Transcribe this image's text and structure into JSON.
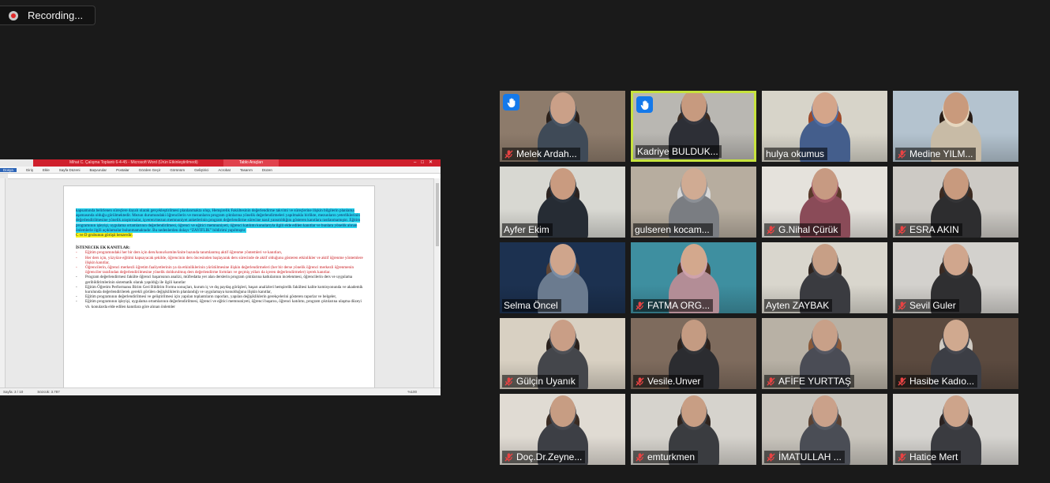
{
  "recording": {
    "label": "Recording..."
  },
  "word": {
    "title_doc": "Mihat C. Çalışma Toplantı 6-4-45 - Microsoft Word (Ürün Etkinleştirilmedi)",
    "table_tools": "Tablo Araçları",
    "tabs": [
      "Dosya",
      "Giriş",
      "Ekle",
      "Sayfa Düzeni",
      "Başvurular",
      "Postalar",
      "Gözden Geçir",
      "Görünüm",
      "Geliştirici",
      "Acrobat",
      "Tasarım",
      "Düzen"
    ],
    "status_page": "Sayfa: 3 / 10",
    "status_words": "Sözcük: 3.787",
    "status_zoom": "%100",
    "highlight_para": "kapsamında belirlenen süreçlere dayalı olarak gerçekleştirilmesi planlanmakta olup, Hemşirelik Fakültesinin değerlendirme takvimi ve süreçlerine ilişkin bilgilerin planlama aşamasında olduğu görülmektedir. Mezun durumundaki öğrencilerin ve mezunların program çıktılarına yönelik değerlendirmeleri yapılmakla birlikte, mezunların yeterliklerinin değerlendirilmesine yönelik araştırmalar, işveren/mezun memnuniyet anketlerinin program değerlendirme sürecine nasıl yansıtıldığını gösteren kanıtlara rastlanmamıştır. Eğitim programının işleyişi, uygulama ortamlarının değerlendirilmesi, öğrenci ve eğitici memnuniyeti, öğrenci katılımı konularıyla ilgili elde edilen kanıtlar ve bunlara yönelik alınan önlemlerle ilgili açıklamalar bulunmamaktadır. Bu nedenlerden dolayı “ZAYIFLIK” bildirimi yapılmıştır.",
    "yellow_line": "C ve D grubunun görüşü benzerdir.",
    "heading": "İSTENECEK EK KANITLAR:",
    "bullets": [
      {
        "text": "Eğitim programındaki her bir ders için ders/konu/komite/ünite bazında tanımlanmış aktif öğrenme yöntemleri ve kanıtları,",
        "color": "red"
      },
      {
        "text": "Her ders için, yüzyüze eğitimi kapsayacak şekilde, öğrencinin ders öncesinden başlayarak ders sürecinde de aktif olduğunu gösteren etkinlikler ve aktif öğrenme yöntemlere ilişkin kanıtlar,",
        "color": "red"
      },
      {
        "text": "Öğrencilerin, öğrenci merkezli öğretim faaliyetlerinin ya da etkinliklerinin yürütülmesine ilişkin değerlendirmeleri (her bir derse yönelik öğrenci merkezli öğrenmenin öğrenciler tarafından değerlendirilmesine yönelik doldurulmuş ders değerlendirme formları ve geçmiş yılları da içeren değerlendirmeler) içerek kanıtlar.",
        "color": "red"
      },
      {
        "text": "Program değerlendirmesi fakülte öğrenci başarısının analizi, müfredatta yer alan derslerin program çıktılarına katkılarının incelenmesi, öğrencilerin ders ve uygulama geribildirimlerinin sistematik olarak yapıldığı ile ilgili kanıtlar",
        "color": "black"
      },
      {
        "text": "Eğitim Öğretim Performansı Birim Geri Bildirim Formu sonuçları, kurum iç ve dış paydaş görüşleri, başarı analizleri hemşirelik fakültesi kalite komisyonunda ve akademik kurulunda değerlendirilerek gerekli görülen değişikliklerin planlandığı ve uygulamaya konulduğuna ilişkin kanıtlar,",
        "color": "black"
      },
      {
        "text": "Eğitim programının değerlendirilmesi ve geliştirilmesi için yapılan toplantıların raporları, yapılan değişikliklerin gerekçelerini gösteren raporlar ve belgeler,",
        "color": "black"
      },
      {
        "text": "Eğitim programının işleyişi, uygulama ortamlarının değerlendirilmesi, öğrenci ve eğitici memnuniyeti, öğrenci başarısı, öğrenci katılımı, program çıktılarına ulaşma düzeyi vb. konularda elde edilen kanıtlara göre alınan önlemler",
        "color": "black"
      }
    ]
  },
  "participants": [
    {
      "name": "Melek Ardah...",
      "muted": true,
      "hand": true,
      "active": false,
      "bg": "#8d7b6b",
      "skin": "#caa088",
      "hair": "#2b211b",
      "shirt": "#3f4a57"
    },
    {
      "name": "Kadriye BULDUK...",
      "muted": false,
      "hand": true,
      "active": true,
      "bg": "#b9b7b2",
      "skin": "#c79a7f",
      "hair": "#3a2a20",
      "shirt": "#2d2f36"
    },
    {
      "name": "hulya okumus",
      "muted": false,
      "hand": false,
      "active": false,
      "bg": "#d7d4c9",
      "skin": "#d4a58a",
      "hair": "#9c4a2b",
      "shirt": "#445e8c"
    },
    {
      "name": "Medine YILM...",
      "muted": true,
      "hand": false,
      "active": false,
      "bg": "#b4c3cf",
      "skin": "#c99a7c",
      "hair": "#2a1d16",
      "shirt": "#c8bba6"
    },
    {
      "name": "Ayfer Ekim",
      "muted": false,
      "hand": false,
      "active": false,
      "bg": "#d8d8d2",
      "skin": "#c99b80",
      "hair": "#2c2320",
      "shirt": "#262c34"
    },
    {
      "name": "gulseren kocam...",
      "muted": false,
      "hand": false,
      "active": false,
      "bg": "#b7ad9f",
      "skin": "#d0ab93",
      "hair": "#d8d8d8",
      "shirt": "#7a7d82"
    },
    {
      "name": "G.Nihal Çürük",
      "muted": true,
      "hand": false,
      "active": false,
      "bg": "#e5e2dc",
      "skin": "#c79a82",
      "hair": "#5a3a2a",
      "shirt": "#8a4b58"
    },
    {
      "name": "ESRA AKIN",
      "muted": true,
      "hand": false,
      "active": false,
      "bg": "#cdcac5",
      "skin": "#c89a7e",
      "hair": "#3b2a20",
      "shirt": "#2d2d2f"
    },
    {
      "name": "Selma Öncel",
      "muted": false,
      "hand": false,
      "active": false,
      "bg": "#1c3150",
      "skin": "#cfa58c",
      "hair": "#5e4434",
      "shirt": "#6b7b8f"
    },
    {
      "name": "FATMA ORG...",
      "muted": true,
      "hand": false,
      "active": false,
      "bg": "#3e8fa0",
      "skin": "#d3a88d",
      "hair": "#4d3225",
      "shirt": "#b38d96"
    },
    {
      "name": "Ayten ZAYBAK",
      "muted": false,
      "hand": false,
      "active": false,
      "bg": "#d9d6cd",
      "skin": "#c79f86",
      "hair": "#2f241e",
      "shirt": "#3a3b40"
    },
    {
      "name": "Sevil Guler",
      "muted": true,
      "hand": false,
      "active": false,
      "bg": "#d3d1cd",
      "skin": "#d0a68d",
      "hair": "#3a2a22",
      "shirt": "#2f2f31"
    },
    {
      "name": "Gülçin Uyanık",
      "muted": true,
      "hand": false,
      "active": false,
      "bg": "#d8d0c2",
      "skin": "#c99e86",
      "hair": "#2a211d",
      "shirt": "#44464b"
    },
    {
      "name": "Vesile.Unver",
      "muted": true,
      "hand": false,
      "active": false,
      "bg": "#7e6b5d",
      "skin": "#c49b82",
      "hair": "#2c211b",
      "shirt": "#2b2c30"
    },
    {
      "name": "AFİFE YURTTAŞ",
      "muted": true,
      "hand": false,
      "active": false,
      "bg": "#b8b1a5",
      "skin": "#c8a088",
      "hair": "#8a5a3a",
      "shirt": "#4a4c55"
    },
    {
      "name": "Hasibe Kadıo...",
      "muted": true,
      "hand": false,
      "active": false,
      "bg": "#5b4a3f",
      "skin": "#d0a98f",
      "hair": "#cfcac2",
      "shirt": "#3c3e45"
    },
    {
      "name": "Doç.Dr.Zeyne...",
      "muted": true,
      "hand": false,
      "active": false,
      "bg": "#e0dbd3",
      "skin": "#c79d83",
      "hair": "#3a2b22",
      "shirt": "#3d3f45"
    },
    {
      "name": "emturkmen",
      "muted": true,
      "hand": false,
      "active": false,
      "bg": "#d6d3cd",
      "skin": "#c89e84",
      "hair": "#2e231d",
      "shirt": "#3a3c40"
    },
    {
      "name": "İMATULLAH ...",
      "muted": true,
      "hand": false,
      "active": false,
      "bg": "#c9c5bd",
      "skin": "#caa18a",
      "hair": "#5a4233",
      "shirt": "#4a4d55"
    },
    {
      "name": "Hatice Mert",
      "muted": true,
      "hand": false,
      "active": false,
      "bg": "#d6d4d0",
      "skin": "#cda48b",
      "hair": "#2b2220",
      "shirt": "#3a3b40"
    }
  ]
}
